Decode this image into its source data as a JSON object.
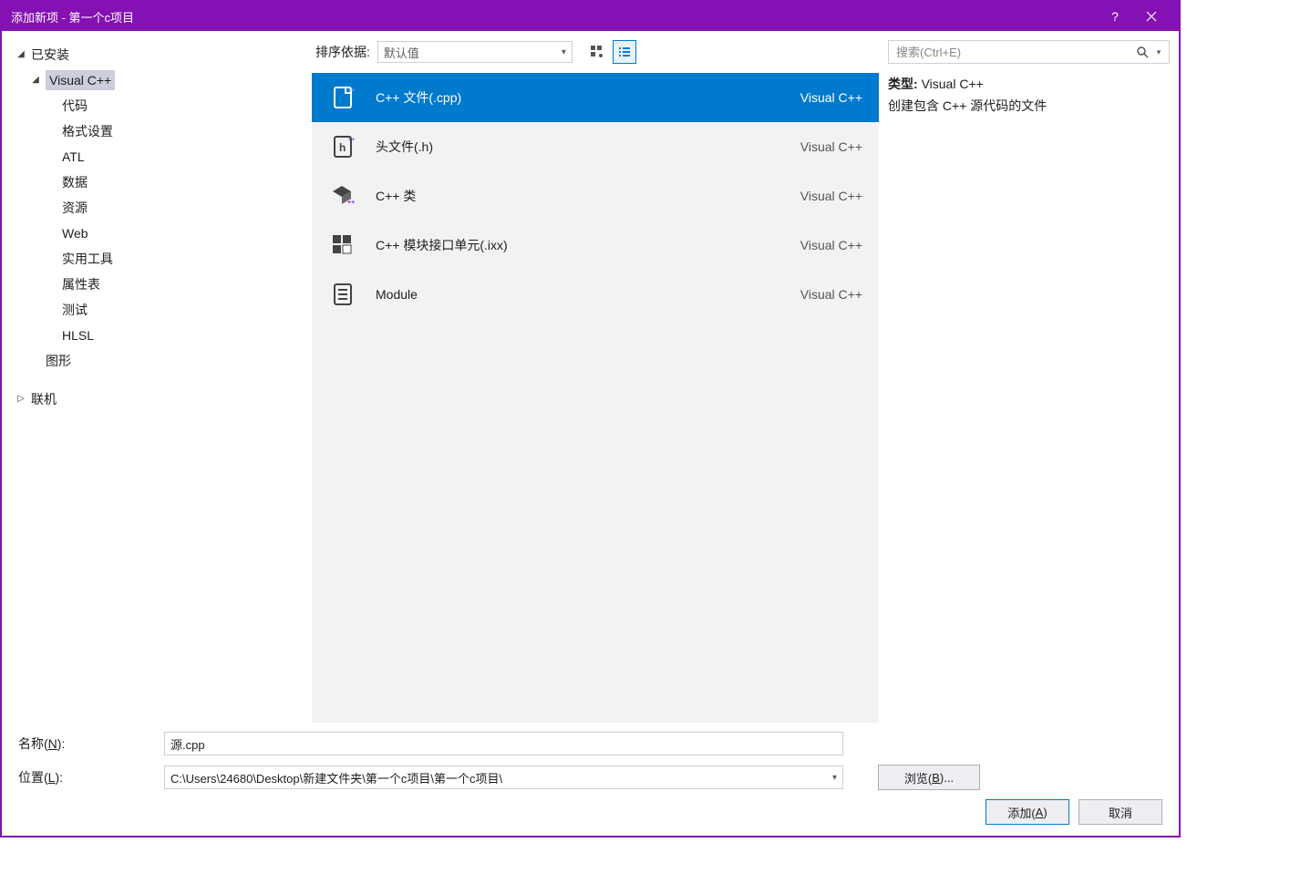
{
  "title": "添加新项 - 第一个c项目",
  "sidebar": {
    "installed": "已安装",
    "online": "联机",
    "vcpp": "Visual C++",
    "children": [
      "代码",
      "格式设置",
      "ATL",
      "数据",
      "资源",
      "Web",
      "实用工具",
      "属性表",
      "测试",
      "HLSL"
    ],
    "graphics": "图形"
  },
  "center": {
    "sort_label": "排序依据:",
    "sort_value": "默认值",
    "templates": [
      {
        "name": "C++ 文件(.cpp)",
        "lang": "Visual C++"
      },
      {
        "name": "头文件(.h)",
        "lang": "Visual C++"
      },
      {
        "name": "C++ 类",
        "lang": "Visual C++"
      },
      {
        "name": "C++ 模块接口单元(.ixx)",
        "lang": "Visual C++"
      },
      {
        "name": "Module",
        "lang": "Visual C++"
      }
    ]
  },
  "right": {
    "search_placeholder": "搜索(Ctrl+E)",
    "type_label": "类型:",
    "type_value": "Visual C++",
    "description": "创建包含 C++ 源代码的文件"
  },
  "form": {
    "name_label_prefix": "名称(",
    "name_label_key": "N",
    "name_label_suffix": "):",
    "name_value": "源.cpp",
    "location_label_prefix": "位置(",
    "location_label_key": "L",
    "location_label_suffix": "):",
    "location_value": "C:\\Users\\24680\\Desktop\\新建文件夹\\第一个c项目\\第一个c项目\\",
    "browse_prefix": "浏览(",
    "browse_key": "B",
    "browse_suffix": ")...",
    "add_prefix": "添加(",
    "add_key": "A",
    "add_suffix": ")",
    "cancel": "取消"
  }
}
